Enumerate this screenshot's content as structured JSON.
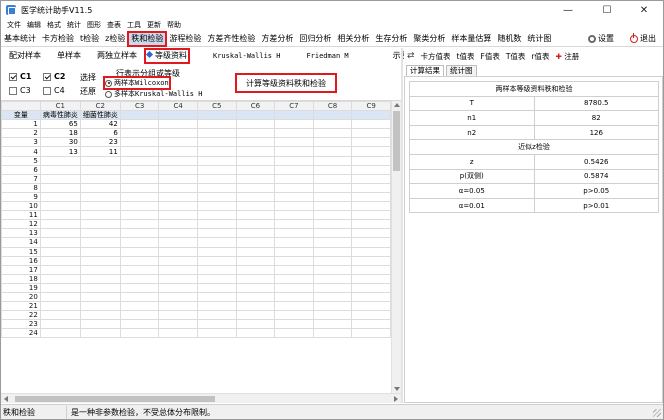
{
  "window": {
    "title": "医学统计助手V11.5",
    "controls": [
      "—",
      "☐",
      "✕"
    ]
  },
  "menu": [
    "文件",
    "编辑",
    "格式",
    "统计",
    "图形",
    "查表",
    "工具",
    "更新",
    "帮助"
  ],
  "modules": [
    "基本统计",
    "卡方检验",
    "t检验",
    "z检验",
    "秩和检验",
    "游程检验",
    "方差齐性检验",
    "方差分析",
    "回归分析",
    "相关分析",
    "生存分析",
    "聚类分析",
    "样本量估算",
    "随机数",
    "统计图"
  ],
  "selected_module": "秩和检验",
  "module_right": {
    "settings": "设置",
    "exit": "退出"
  },
  "subtabs": [
    {
      "label": "配对样本",
      "mono": false,
      "selected": false
    },
    {
      "label": "单样本",
      "mono": false,
      "selected": false
    },
    {
      "label": "两独立样本",
      "mono": false,
      "selected": false
    },
    {
      "label": "等级资料",
      "mono": false,
      "selected": true
    },
    {
      "label": "Kruskal-Wallis H",
      "mono": true,
      "selected": false
    },
    {
      "label": "Friedman M",
      "mono": true,
      "selected": false
    },
    {
      "label": "示例",
      "mono": false,
      "selected": false
    }
  ],
  "options": {
    "c1": "C1",
    "c2": "C2",
    "c3": "C3",
    "c4": "C4",
    "select_label": "选择",
    "restore_label": "还原",
    "group_title": "行表示分组或等级",
    "radio1": "两样本Wilcoxon",
    "radio2": "多样本Kruskal-Wallis H",
    "calc_button": "计算等级资料秩和检验"
  },
  "grid": {
    "columns": [
      "C1",
      "C2",
      "C3",
      "C4",
      "C5",
      "C6",
      "C7",
      "C8",
      "C9"
    ],
    "corner_label": "变量",
    "column_names": [
      "病毒性肺炎",
      "细菌性肺炎",
      "",
      "",
      "",
      "",
      "",
      "",
      ""
    ],
    "rows": [
      [
        "65",
        "42"
      ],
      [
        "18",
        "6"
      ],
      [
        "30",
        "23"
      ],
      [
        "13",
        "11"
      ]
    ],
    "row_count": 24
  },
  "right_tools": {
    "cross": "卡方值表",
    "t": "t值表",
    "f": "F值表",
    "T": "T值表",
    "r": "r值表",
    "reg": "注册"
  },
  "right_tabs": [
    "计算结果",
    "统计图"
  ],
  "result": {
    "section1": "两样本等级资料秩和检验",
    "rows1": [
      [
        "T",
        "8780.5"
      ],
      [
        "n1",
        "82"
      ],
      [
        "n2",
        "126"
      ]
    ],
    "section2": "近似z检验",
    "rows2": [
      [
        "z",
        "0.5426"
      ],
      [
        "p(双侧)",
        "0.5874"
      ],
      [
        "α=0.05",
        "p>0.05"
      ],
      [
        "α=0.01",
        "p>0.01"
      ]
    ]
  },
  "status": {
    "left": "秩和检验",
    "message": "是一种非参数检验，不受总体分布限制。"
  }
}
